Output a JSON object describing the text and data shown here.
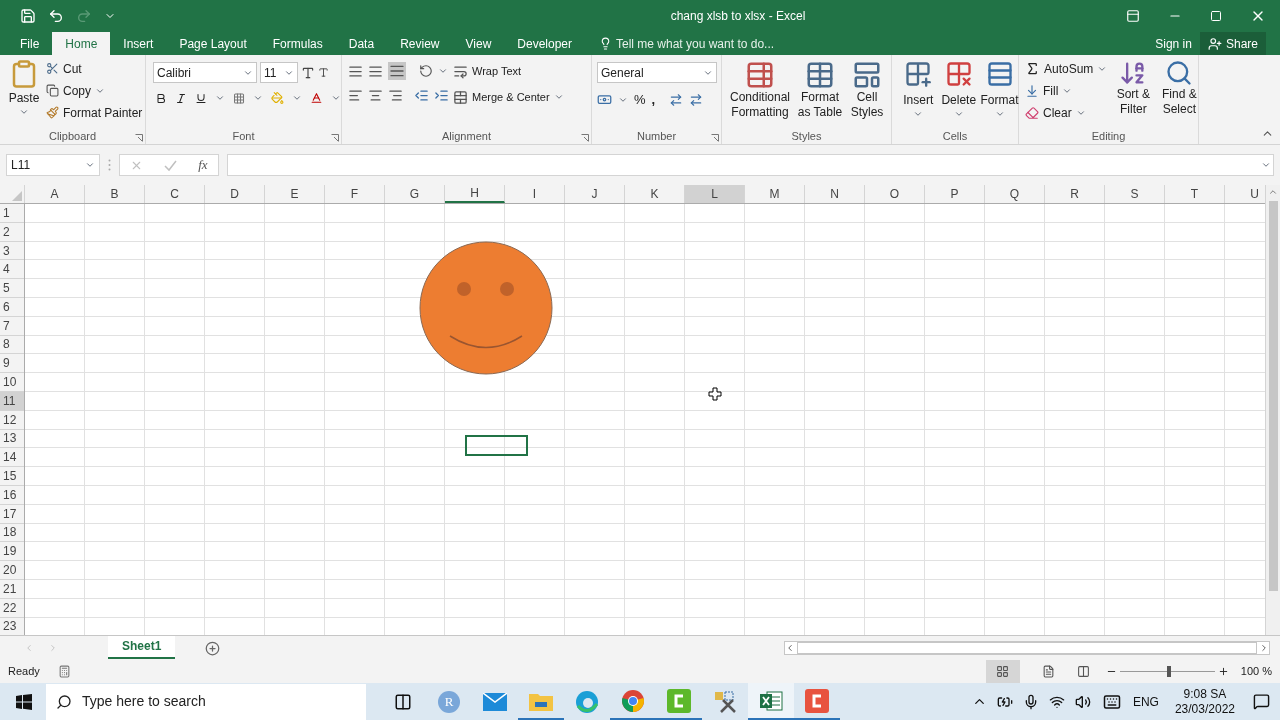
{
  "window": {
    "title": "chang xlsb to xlsx - Excel"
  },
  "ribbon_tabs": [
    {
      "label": "File",
      "selected": false
    },
    {
      "label": "Home",
      "selected": true
    },
    {
      "label": "Insert",
      "selected": false
    },
    {
      "label": "Page Layout",
      "selected": false
    },
    {
      "label": "Formulas",
      "selected": false
    },
    {
      "label": "Data",
      "selected": false
    },
    {
      "label": "Review",
      "selected": false
    },
    {
      "label": "View",
      "selected": false
    },
    {
      "label": "Developer",
      "selected": false
    }
  ],
  "tell_me": {
    "placeholder": "Tell me what you want to do..."
  },
  "sign_in": "Sign in",
  "share": "Share",
  "clipboard": {
    "paste": "Paste",
    "cut": "Cut",
    "copy": "Copy",
    "format_painter": "Format Painter",
    "label": "Clipboard"
  },
  "font": {
    "name": "Calibri",
    "size": "11",
    "label": "Font"
  },
  "alignment": {
    "wrap_text": "Wrap Text",
    "merge_center": "Merge & Center",
    "label": "Alignment"
  },
  "number": {
    "format": "General",
    "percent": "%",
    "comma": ",",
    "label": "Number"
  },
  "styles": {
    "buttons": [
      "Conditional Formatting",
      "Format as Table",
      "Cell Styles"
    ],
    "label": "Styles"
  },
  "cells": {
    "buttons": [
      "Insert",
      "Delete",
      "Format"
    ],
    "label": "Cells"
  },
  "editing": {
    "autosum": "AutoSum",
    "fill": "Fill",
    "clear": "Clear",
    "sort_filter": "Sort & Filter",
    "find_select": "Find & Select",
    "label": "Editing"
  },
  "formula_bar": {
    "name_box": "L11",
    "fx": "fx"
  },
  "columns": [
    {
      "label": "A",
      "selected": false,
      "underlined": false
    },
    {
      "label": "B",
      "selected": false,
      "underlined": false
    },
    {
      "label": "C",
      "selected": false,
      "underlined": false
    },
    {
      "label": "D",
      "selected": false,
      "underlined": false
    },
    {
      "label": "E",
      "selected": false,
      "underlined": false
    },
    {
      "label": "F",
      "selected": false,
      "underlined": false
    },
    {
      "label": "G",
      "selected": false,
      "underlined": false
    },
    {
      "label": "H",
      "selected": false,
      "underlined": true
    },
    {
      "label": "I",
      "selected": false,
      "underlined": false
    },
    {
      "label": "J",
      "selected": false,
      "underlined": false
    },
    {
      "label": "K",
      "selected": false,
      "underlined": false
    },
    {
      "label": "L",
      "selected": true,
      "underlined": false
    },
    {
      "label": "M",
      "selected": false,
      "underlined": false
    },
    {
      "label": "N",
      "selected": false,
      "underlined": false
    },
    {
      "label": "O",
      "selected": false,
      "underlined": false
    },
    {
      "label": "P",
      "selected": false,
      "underlined": false
    },
    {
      "label": "Q",
      "selected": false,
      "underlined": false
    },
    {
      "label": "R",
      "selected": false,
      "underlined": false
    },
    {
      "label": "S",
      "selected": false,
      "underlined": false
    },
    {
      "label": "T",
      "selected": false,
      "underlined": false
    },
    {
      "label": "U",
      "selected": false,
      "underlined": false
    }
  ],
  "rows": [
    {
      "label": "1",
      "selected": false
    },
    {
      "label": "2",
      "selected": false
    },
    {
      "label": "3",
      "selected": false
    },
    {
      "label": "4",
      "selected": false
    },
    {
      "label": "5",
      "selected": false
    },
    {
      "label": "6",
      "selected": false
    },
    {
      "label": "7",
      "selected": false
    },
    {
      "label": "8",
      "selected": false
    },
    {
      "label": "9",
      "selected": false
    },
    {
      "label": "10",
      "selected": false
    },
    {
      "label": "11",
      "selected": true
    },
    {
      "label": "12",
      "selected": false
    },
    {
      "label": "13",
      "selected": false
    },
    {
      "label": "14",
      "selected": false
    },
    {
      "label": "15",
      "selected": false
    },
    {
      "label": "16",
      "selected": false
    },
    {
      "label": "17",
      "selected": false
    },
    {
      "label": "18",
      "selected": false
    },
    {
      "label": "19",
      "selected": false
    },
    {
      "label": "20",
      "selected": false
    },
    {
      "label": "21",
      "selected": false
    },
    {
      "label": "22",
      "selected": false
    },
    {
      "label": "23",
      "selected": false
    }
  ],
  "sheet_tabs": [
    {
      "label": "Sheet1",
      "selected": true
    }
  ],
  "status_bar": {
    "status": "Ready",
    "zoom": "100 %",
    "zoom_slider": {
      "level": 0.52
    }
  },
  "taskbar": {
    "search": {
      "placeholder": "Type here to search"
    },
    "avatar_letter": "R",
    "language": "ENG",
    "time": "9:08 SA",
    "date": "23/03/2022"
  }
}
